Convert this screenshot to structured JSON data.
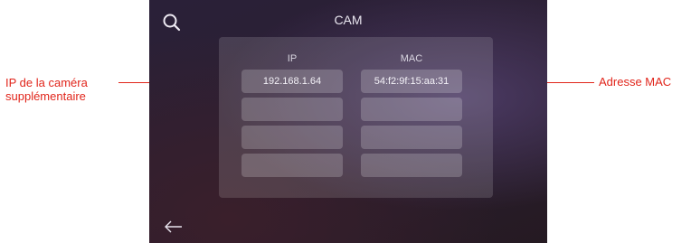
{
  "screen": {
    "title": "CAM",
    "icons": {
      "search": "search-icon",
      "back": "arrow-left-icon"
    }
  },
  "table": {
    "headers": {
      "ip": "IP",
      "mac": "MAC"
    },
    "rows": [
      {
        "ip": "192.168.1.64",
        "mac": "54:f2:9f:15:aa:31"
      },
      {
        "ip": "",
        "mac": ""
      },
      {
        "ip": "",
        "mac": ""
      },
      {
        "ip": "",
        "mac": ""
      }
    ]
  },
  "annotations": {
    "left_line1": "IP de la caméra",
    "left_line2": "supplémentaire",
    "right": "Adresse MAC",
    "color": "#e1251b"
  }
}
